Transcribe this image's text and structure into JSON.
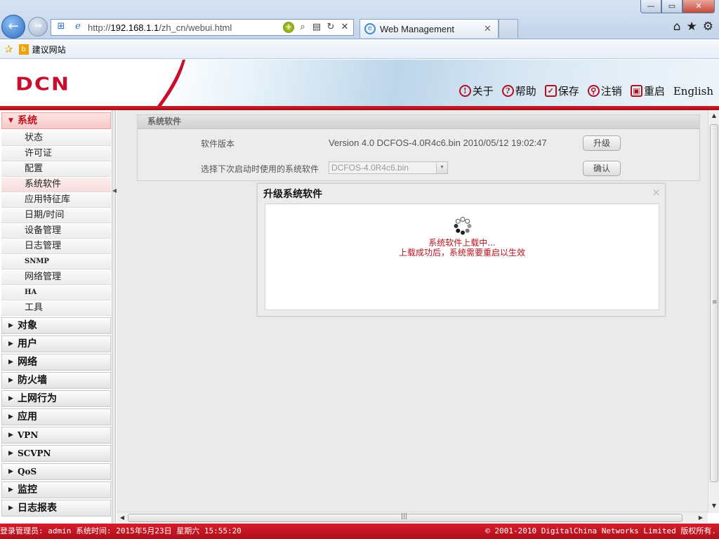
{
  "browser": {
    "url_prefix": "http://",
    "url_host": "192.168.1.1",
    "url_path": "/zh_cn/webui.html",
    "tab_title": "Web Management",
    "favorites_link": "建议网站",
    "window_buttons": {
      "minimize": "—",
      "maximize": "▭",
      "close": "✕"
    }
  },
  "header": {
    "logo": "DCN",
    "links": [
      {
        "icon": "!",
        "label": "关于"
      },
      {
        "icon": "?",
        "label": "帮助"
      },
      {
        "icon": "✓",
        "label": "保存"
      },
      {
        "icon": "⚲",
        "label": "注销"
      },
      {
        "icon": "▣",
        "label": "重启"
      }
    ],
    "language": "English"
  },
  "sidebar": {
    "active_group": "系统",
    "system_items": [
      "状态",
      "许可证",
      "配置",
      "系统软件",
      "应用特征库",
      "日期/时间",
      "设备管理",
      "日志管理",
      "SNMP",
      "网络管理",
      "HA",
      "工具"
    ],
    "selected_item": "系统软件",
    "groups": [
      "对象",
      "用户",
      "网络",
      "防火墙",
      "上网行为",
      "应用",
      "VPN",
      "SCVPN",
      "QoS",
      "监控",
      "日志报表"
    ]
  },
  "panel": {
    "title": "系统软件",
    "version_label": "软件版本",
    "version_value": "Version 4.0 DCFOS-4.0R4c6.bin 2010/05/12 19:02:47",
    "upgrade_button": "升级",
    "next_boot_label": "选择下次启动时使用的系统软件",
    "next_boot_value": "DCFOS-4.0R4c6.bin",
    "confirm_button": "确认"
  },
  "dialog": {
    "title": "升级系统软件",
    "close": "×",
    "message_1": "系统软件上载中...",
    "message_2": "上载成功后，系统需要重启以生效"
  },
  "status": {
    "left": "登录管理员: admin 系统时间: 2015年5月23日 星期六 15:55:20",
    "right": "© 2001-2010 DigitalChina Networks Limited 版权所有."
  }
}
